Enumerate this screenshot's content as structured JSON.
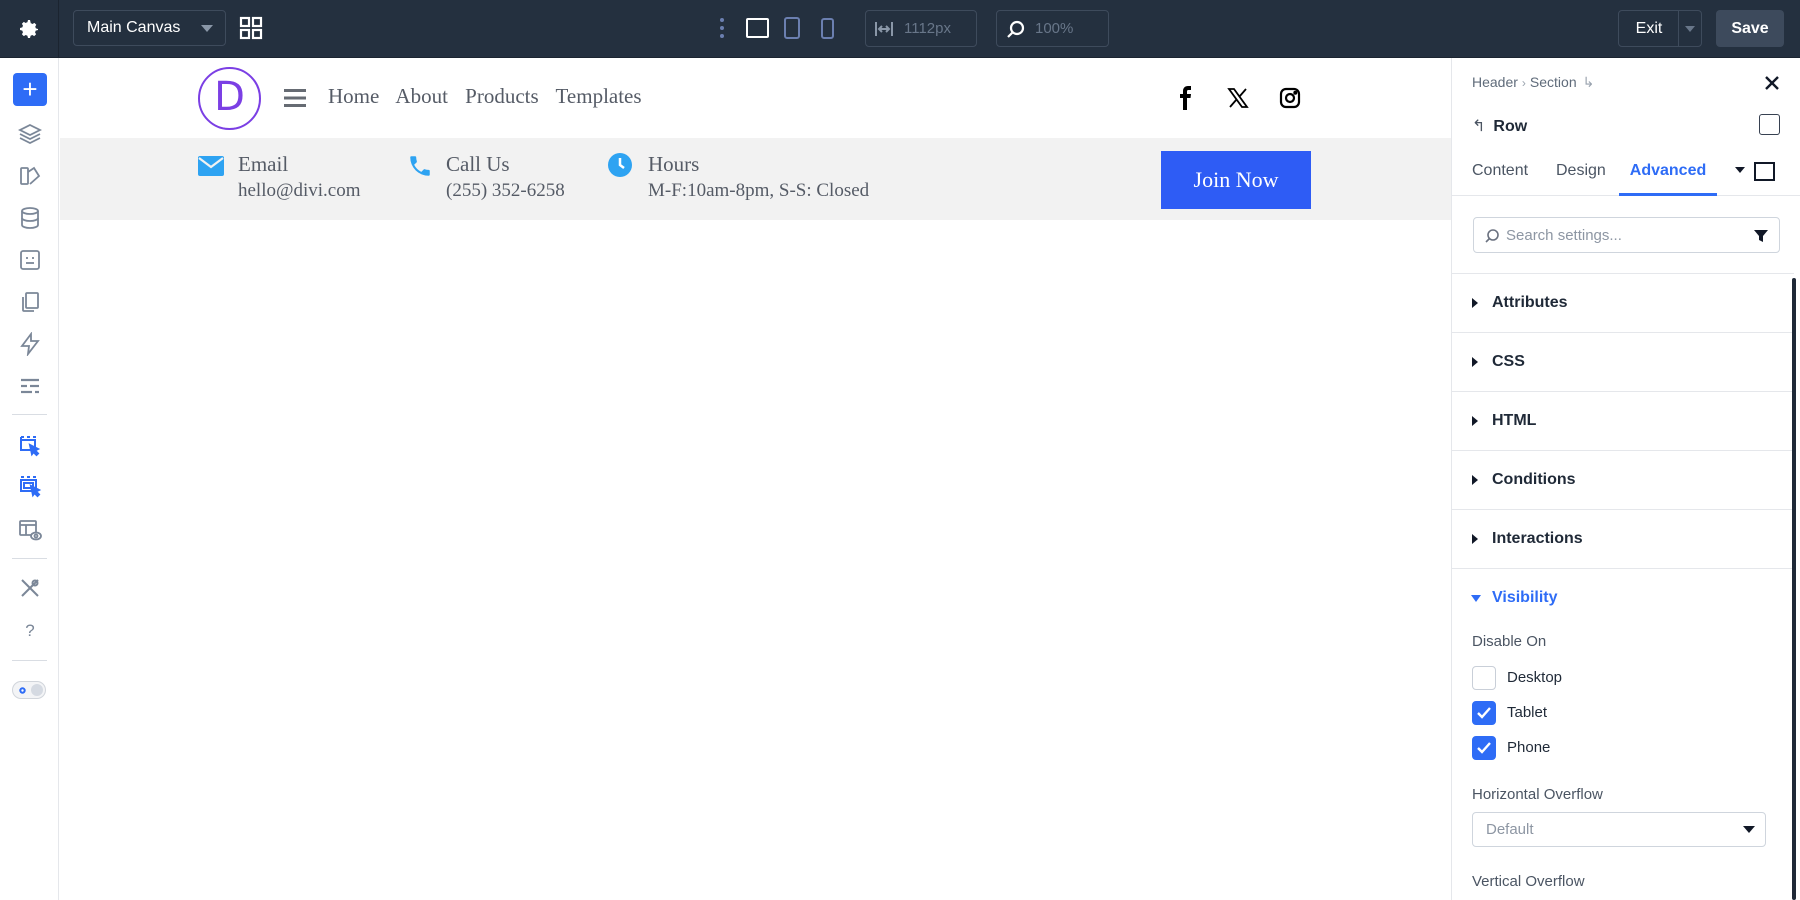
{
  "topbar": {
    "canvas_select": "Main Canvas",
    "width_value": "1112px",
    "zoom_value": "100%",
    "exit_label": "Exit",
    "save_label": "Save"
  },
  "sidebar": {
    "icons": [
      "add-icon",
      "layers-icon",
      "theme-builder-icon",
      "database-icon",
      "forms-icon",
      "pages-icon",
      "lightning-icon",
      "list-icon",
      "select-tool-icon",
      "multi-select-icon",
      "preview-icon",
      "tools-icon",
      "help-icon",
      "dark-mode-toggle"
    ]
  },
  "site": {
    "logo_letter": "D",
    "nav": [
      "Home",
      "About",
      "Products",
      "Templates"
    ],
    "info": [
      {
        "title": "Email",
        "sub": "hello@divi.com"
      },
      {
        "title": "Call Us",
        "sub": "(255) 352-6258"
      },
      {
        "title": "Hours",
        "sub": "M-F:10am-8pm, S-S: Closed"
      }
    ],
    "join_label": "Join Now",
    "accent_purple": "#7b3fe4",
    "accent_blue": "#2e5cf5",
    "info_icon_color": "#2ea3f2"
  },
  "panel": {
    "breadcrumb": [
      "Header",
      "Section"
    ],
    "title": "Row",
    "tabs": [
      "Content",
      "Design",
      "Advanced"
    ],
    "active_tab": "Advanced",
    "search_placeholder": "Search settings...",
    "sections": [
      "Attributes",
      "CSS",
      "HTML",
      "Conditions",
      "Interactions"
    ],
    "visibility": {
      "label": "Visibility",
      "disable_on_label": "Disable On",
      "options": [
        {
          "label": "Desktop",
          "checked": false
        },
        {
          "label": "Tablet",
          "checked": true
        },
        {
          "label": "Phone",
          "checked": true
        }
      ],
      "horizontal_overflow_label": "Horizontal Overflow",
      "horizontal_overflow_value": "Default",
      "vertical_overflow_label": "Vertical Overflow"
    },
    "accent": "#2e6cf6"
  }
}
